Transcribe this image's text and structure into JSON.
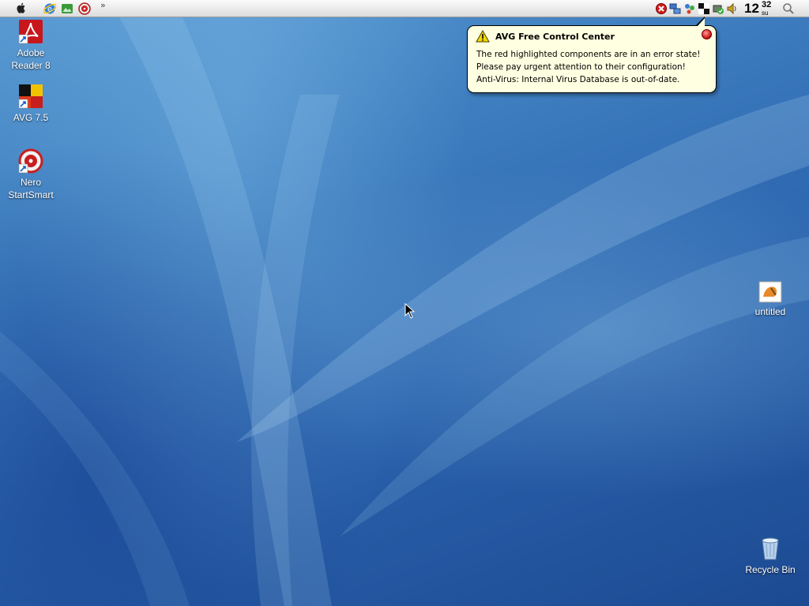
{
  "menubar": {
    "chevron": "»",
    "left_icons": [
      "apple-icon",
      "internet-explorer-icon",
      "picture-icon",
      "nero-icon"
    ],
    "tray_icons": [
      "avg-error-icon",
      "network-icon",
      "messenger-icon",
      "avg-tray-icon",
      "safely-remove-icon",
      "volume-icon"
    ],
    "clock": {
      "hour": "12",
      "minute": "32",
      "day": "su"
    }
  },
  "balloon": {
    "title": "AVG Free Control Center",
    "lines": [
      "The red highlighted components are in an error state!",
      "Please pay urgent attention to their configuration!",
      "Anti-Virus: Internal Virus Database is out-of-date."
    ]
  },
  "desktop": {
    "icons": [
      {
        "label_line1": "Adobe",
        "label_line2": "Reader 8",
        "icon": "adobe-reader-icon"
      },
      {
        "label_line1": "AVG 7.5",
        "label_line2": "",
        "icon": "avg-icon"
      },
      {
        "label_line1": "Nero",
        "label_line2": "StartSmart",
        "icon": "nero-icon"
      },
      {
        "label_line1": "untitled",
        "label_line2": "",
        "icon": "untitled-file-icon"
      },
      {
        "label_line1": "Recycle Bin",
        "label_line2": "",
        "icon": "recycle-bin-icon"
      }
    ]
  },
  "colors": {
    "balloon_bg": "#ffffe1",
    "wallpaper": "#3f7fc0",
    "error_red": "#d21d1d"
  }
}
